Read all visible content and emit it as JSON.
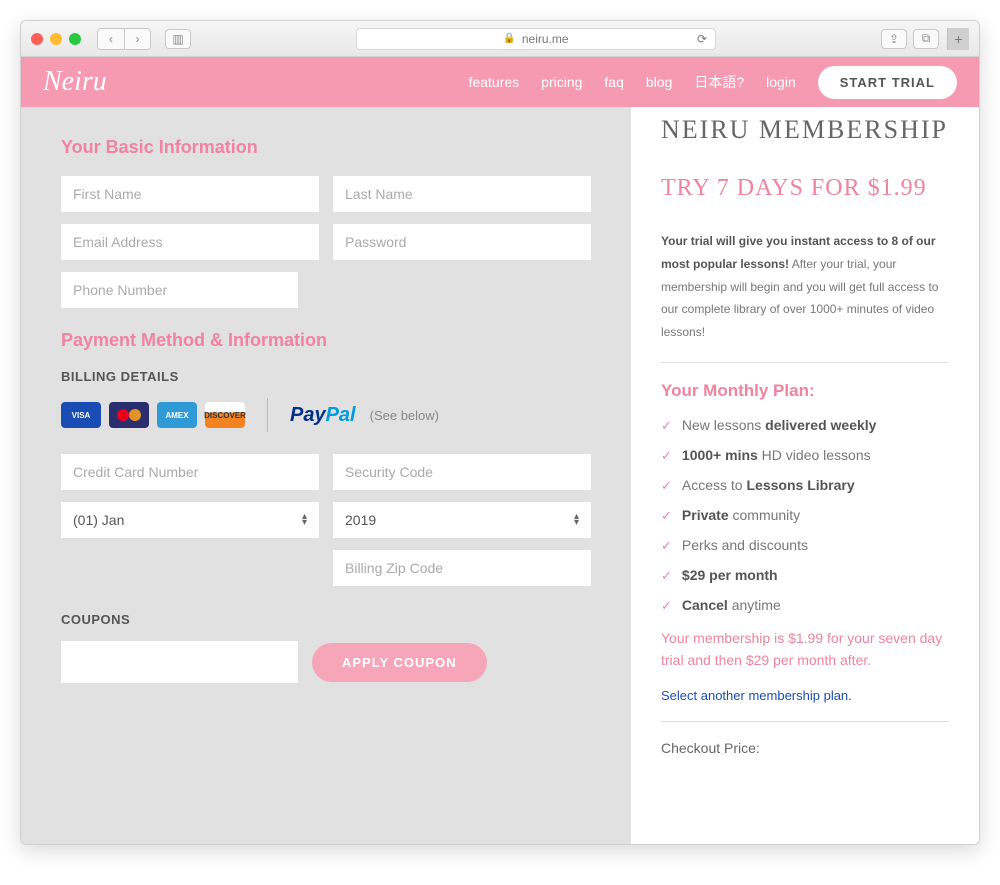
{
  "browser": {
    "url": "neiru.me"
  },
  "header": {
    "logo": "Neiru",
    "nav": [
      "features",
      "pricing",
      "faq",
      "blog",
      "日本語?",
      "login"
    ],
    "cta": "START TRIAL"
  },
  "form": {
    "basic_title": "Your Basic Information",
    "first_name_ph": "First Name",
    "last_name_ph": "Last Name",
    "email_ph": "Email Address",
    "password_ph": "Password",
    "phone_ph": "Phone Number",
    "payment_title": "Payment Method & Information",
    "billing_label": "BILLING DETAILS",
    "see_below": "(See below)",
    "cc_ph": "Credit Card Number",
    "cvc_ph": "Security Code",
    "month_val": "(01) Jan",
    "year_val": "2019",
    "zip_ph": "Billing Zip Code",
    "coupons_label": "COUPONS",
    "apply_btn": "APPLY COUPON",
    "cards": {
      "visa": "VISA",
      "amex": "AMEX",
      "discover": "DISCOVER"
    },
    "paypal": {
      "pay": "Pay",
      "pal": "Pal"
    }
  },
  "sidebar": {
    "membership_title": "NEIRU MEMBERSHIP",
    "trial_title": "TRY 7 DAYS FOR $1.99",
    "desc_bold": "Your trial will give you instant access to 8 of our most popular lessons!",
    "desc_rest": " After your trial, your membership will begin and you will get full access to our complete library of over 1000+ minutes of video lessons!",
    "plan_title": "Your Monthly Plan:",
    "items": [
      {
        "pre": "New lessons ",
        "bold": "delivered weekly",
        "post": ""
      },
      {
        "pre": "",
        "bold": "1000+ mins",
        "post": " HD video lessons"
      },
      {
        "pre": "Access to ",
        "bold": "Lessons Library",
        "post": ""
      },
      {
        "pre": "",
        "bold": "Private",
        "post": " community"
      },
      {
        "pre": "Perks and discounts",
        "bold": "",
        "post": ""
      },
      {
        "pre": "",
        "bold": "$29 per month",
        "post": ""
      },
      {
        "pre": "",
        "bold": "Cancel",
        "post": " anytime"
      }
    ],
    "price_note": "Your membership is $1.99 for your seven day trial and then $29 per month after.",
    "select_plan": "Select another membership plan.",
    "checkout_label": "Checkout Price:"
  }
}
